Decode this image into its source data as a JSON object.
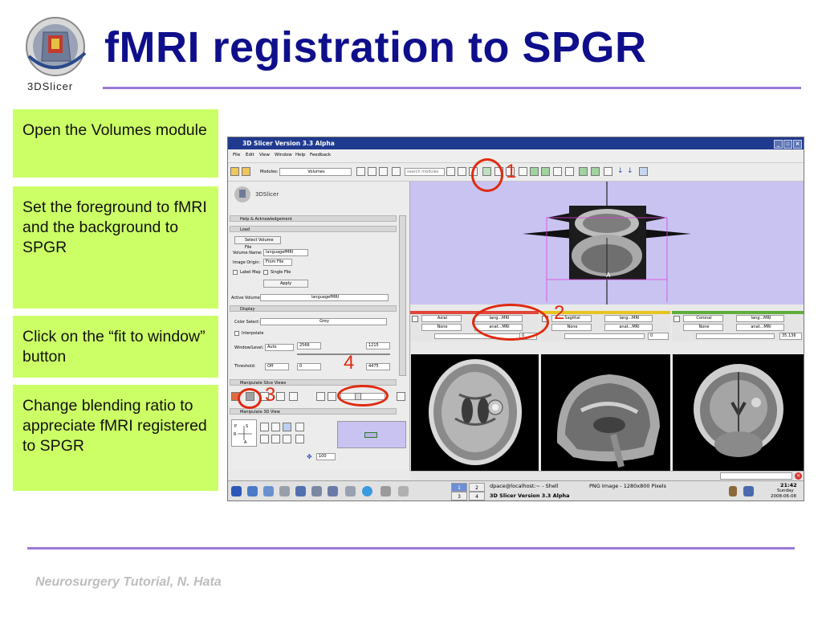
{
  "slide": {
    "title": "fMRI registration to SPGR",
    "logo_text": "3DSlicer",
    "footer": "Neurosurgery Tutorial, N. Hata",
    "steps": [
      "Open the Volumes module",
      "Set the foreground to fMRI and the background to SPGR",
      "Click on the “fit to window” button",
      "Change blending ratio to appreciate fMRI registered to SPGR"
    ],
    "annotations": [
      "1",
      "2",
      "3",
      "4"
    ],
    "colors": {
      "title": "#0f0f8c",
      "step_bg": "#ccff66",
      "rule": "#9a7ad8",
      "annotation": "#e02a10"
    }
  },
  "app": {
    "window_title": "3D Slicer Version 3.3 Alpha",
    "menu": [
      "File",
      "Edit",
      "View",
      "Window",
      "Help",
      "Feedback"
    ],
    "toolbar": {
      "modules_label": "Modules:",
      "module_value": "Volumes",
      "search_placeholder": "search modules"
    },
    "logo": "3DSlicer",
    "panel": {
      "help_section": "Help & Acknowledgement",
      "load_section": "Load",
      "select_volume": "Select Volume File",
      "volume_name_label": "Volume Name:",
      "volume_name_value": "languagefMRI",
      "image_origin_label": "Image Origin:",
      "image_origin_value": "From File",
      "label_map": "Label Map",
      "single_file": "Single File",
      "apply": "Apply",
      "active_volume_label": "Active Volume:",
      "active_volume_value": "languagefMRI",
      "display_section": "Display",
      "color_select_label": "Color Select:",
      "color_select_value": "Grey",
      "interpolate": "Interpolate",
      "window_level_label": "Window/Level:",
      "window_level_mode": "Auto",
      "window_value": "2566",
      "level_value": "1215",
      "threshold_label": "Threshold:",
      "threshold_mode": "Off",
      "threshold_low": "0",
      "threshold_high": "4475",
      "slice_views_section": "Manipulate Slice Views",
      "view3d_section": "Manipulate 3D View",
      "zoom_value": "100"
    },
    "viewer3d_label": "A",
    "slices": [
      {
        "name": "Axial",
        "fg": "lang...MRI",
        "bg": "anat...MRI",
        "label": "None",
        "offset": "0",
        "color": "#e0463a"
      },
      {
        "name": "Sagittal",
        "fg": "lang...MRI",
        "bg": "anat...MRI",
        "label": "None",
        "offset": "0",
        "color": "#e8c41e"
      },
      {
        "name": "Coronal",
        "fg": "lang...MRI",
        "bg": "anat...MRI",
        "label": "None",
        "offset": "35.136",
        "color": "#5fae3c"
      }
    ],
    "taskbar": {
      "pager": [
        "1",
        "2",
        "3",
        "4"
      ],
      "task1": "dpace@localhost:~ - Shell",
      "task2": "PNG Image - 1280x800 Pixels",
      "task3": "3D Slicer Version 3.3 Alpha",
      "time": "21:42",
      "day": "Sunday",
      "date": "2008-06-08"
    }
  }
}
